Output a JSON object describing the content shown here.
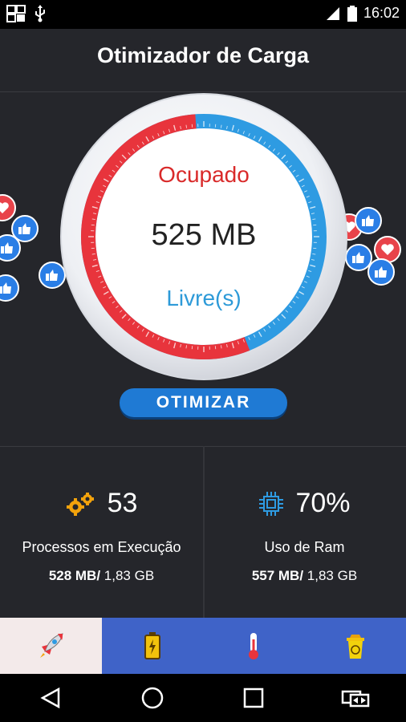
{
  "status_bar": {
    "time": "16:02",
    "left_icons": [
      "notification-icon",
      "usb-icon"
    ],
    "right_icons": [
      "signal-icon",
      "battery-icon"
    ]
  },
  "header": {
    "title": "Otimizador de Carga"
  },
  "gauge": {
    "used_label": "Ocupado",
    "value": "525 MB",
    "free_label": "Livre(s)",
    "colors": {
      "used": "#e8343c",
      "free": "#2e9be2"
    }
  },
  "optimize_button": {
    "label": "OTIMIZAR"
  },
  "stats": {
    "processes": {
      "icon": "gears-icon",
      "count": "53",
      "label": "Processos em Execução",
      "used": "528 MB/",
      "total": " 1,83 GB"
    },
    "ram": {
      "icon": "cpu-icon",
      "percent": "70%",
      "label": "Uso de Ram",
      "used": "557 MB/",
      "total": " 1,83 GB"
    }
  },
  "tabs": [
    {
      "icon": "rocket-icon",
      "active": true
    },
    {
      "icon": "battery-tab-icon",
      "active": false
    },
    {
      "icon": "thermometer-icon",
      "active": false
    },
    {
      "icon": "trash-icon",
      "active": false
    }
  ],
  "nav": [
    "back-icon",
    "home-icon",
    "recents-icon",
    "switch-icon"
  ]
}
